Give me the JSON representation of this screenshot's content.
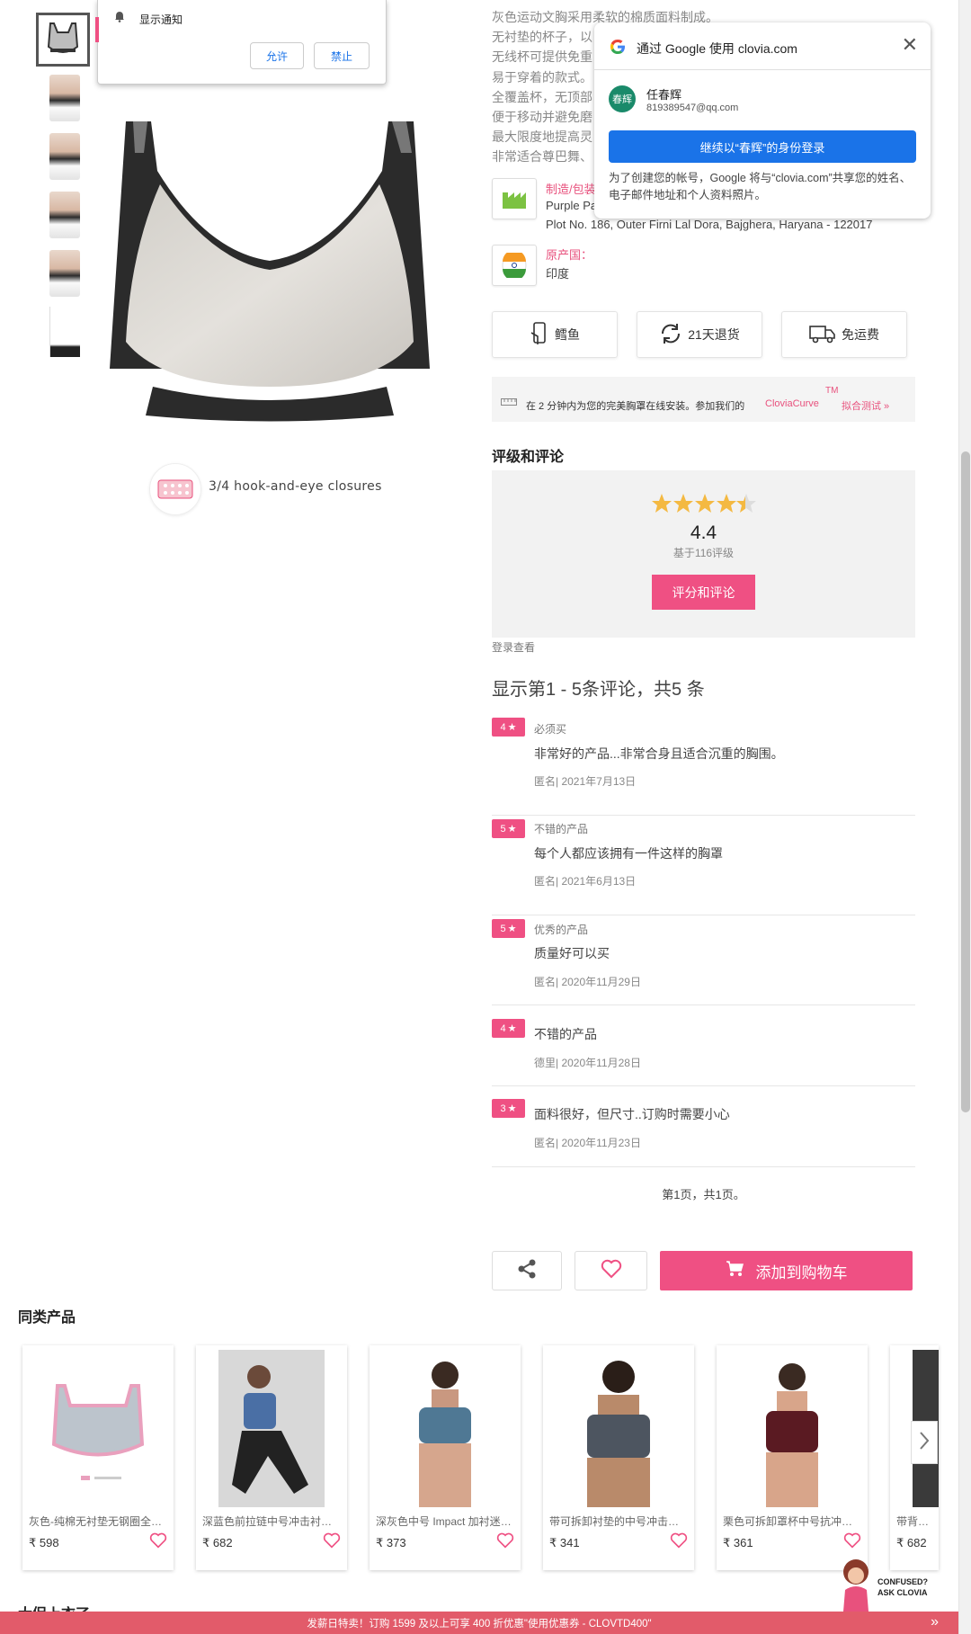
{
  "notification": {
    "title": "显示通知",
    "allow": "允许",
    "block": "禁止"
  },
  "description": {
    "lines": [
      "灰色运动文胸采用柔软的棉质面料制成。",
      "无衬垫的杯子，以",
      "无线杯可提供免重",
      "易于穿着的款式。",
      "全覆盖杯，无顶部",
      "便于移动并避免磨",
      "最大限度地提高灵",
      "非常适合尊巴舞、"
    ],
    "manufacturer_label": "制造/包装",
    "manufacturer_name": "Purple Pa",
    "manufacturer_address": "Plot No. 186, Outer Firni Lal Dora, Bajghera, Haryana - 122017",
    "origin_label": "原产国：",
    "origin_value": "印度"
  },
  "google_popup": {
    "title": "通过 Google 使用 clovia.com",
    "avatar_text": "春辉",
    "user_name": "任春辉",
    "email": "819389547@qq.com",
    "continue_button": "继续以“春辉”的身份登录",
    "note": "为了创建您的帐号，Google 将与“clovia.com”共享您的姓名、电子邮件地址和个人资料照片。"
  },
  "features": [
    {
      "label": "鳕鱼",
      "icon": "cod-phone-icon"
    },
    {
      "label": "21天退货",
      "icon": "return-cycle-icon"
    },
    {
      "label": "免运费",
      "icon": "delivery-truck-icon"
    }
  ],
  "fit_banner": {
    "text": "在 2 分钟内为您的完美胸罩在线安装。参加我们的",
    "brand": "CloviaCurve",
    "tm": "TM",
    "link": "拟合测试 »"
  },
  "hook_caption": "3/4 hook-and-eye closures",
  "ratings": {
    "section_title": "评级和评论",
    "score": "4.4",
    "score_value": 4.4,
    "based_on": "基于116评级",
    "button": "评分和评论",
    "login_link": "登录查看",
    "showing": "显示第1 - 5条评论，共5 条"
  },
  "reviews": [
    {
      "stars": "4",
      "title": "必须买",
      "text": "非常好的产品...非常合身且适合沉重的胸围。",
      "meta": "匿名| 2021年7月13日"
    },
    {
      "stars": "5",
      "title": "不错的产品",
      "text": "每个人都应该拥有一件这样的胸罩",
      "meta": "匿名| 2021年6月13日"
    },
    {
      "stars": "5",
      "title": "优秀的产品",
      "text": "质量好可以买",
      "meta": "匿名| 2020年11月29日"
    },
    {
      "stars": "4",
      "title": "",
      "text": "不错的产品",
      "meta": "德里| 2020年11月28日"
    },
    {
      "stars": "3",
      "title": "",
      "text": "面料很好，但尺寸..订购时需要小心",
      "meta": "匿名| 2020年11月23日"
    }
  ],
  "pagination": "第1页，共1页。",
  "cart_button": "添加到购物车",
  "similar": {
    "title": "同类产品",
    "products": [
      {
        "name": "灰色-纯棉无衬垫无钢圈全罩杯运动文胸",
        "price": "₹ 598"
      },
      {
        "name": "深蓝色前拉链中号冲击衬垫运动文胸",
        "price": "₹ 682"
      },
      {
        "name": "深灰色中号 Impact 加衬迷彩运动文胸",
        "price": "₹ 373"
      },
      {
        "name": "带可拆卸衬垫的中号冲击运动文胸",
        "price": "₹ 341"
      },
      {
        "name": "栗色可拆卸罩杯中号抗冲击运动文胸",
        "price": "₹ 361"
      },
      {
        "name": "带背带背心",
        "price": "₹ 682"
      }
    ]
  },
  "ask_clovia": {
    "line1": "CONFUSED?",
    "line2": "ASK CLOVIA"
  },
  "next_section_title": "大促上衣了",
  "promo_bar": "发薪日特卖！订购 1599 及以上可享 400 折优惠\"使用优惠券 - CLOVTD400\"",
  "colors": {
    "brand_pink": "#ef5083",
    "google_blue": "#1a73e8",
    "promo_red": "#e25b6a"
  }
}
